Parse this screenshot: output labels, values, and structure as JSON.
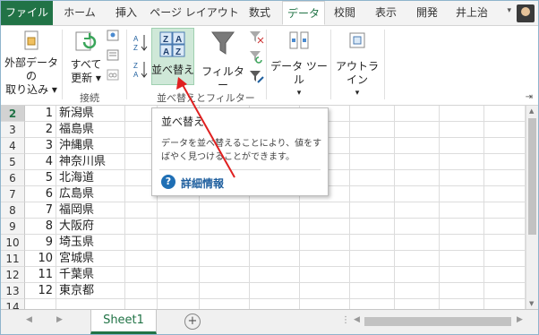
{
  "tabs": {
    "file": "ファイル",
    "home": "ホーム",
    "insert": "挿入",
    "page_layout": "ページ レイアウト",
    "formulas": "数式",
    "data": "データ",
    "review": "校閲",
    "view": "表示",
    "developer": "開発",
    "user": "井上治"
  },
  "ribbon": {
    "external_data": [
      "外部データの",
      "取り込み ▾"
    ],
    "refresh_all": [
      "すべて",
      "更新 ▾"
    ],
    "connections_group": "接続",
    "sort": "並べ替え",
    "filter": "フィルター",
    "sort_filter_group": "並べ替えとフィルター",
    "data_tools": "データ ツール",
    "outline": "アウトライン"
  },
  "tooltip": {
    "title": "並べ替え",
    "body_line1": "データを並べ替えることにより、値をす",
    "body_line2": "ばやく見つけることができます。",
    "more_info": "詳細情報"
  },
  "rows": [
    {
      "num": "2",
      "a": "1",
      "b": "新潟県"
    },
    {
      "num": "3",
      "a": "2",
      "b": "福島県"
    },
    {
      "num": "4",
      "a": "3",
      "b": "沖縄県"
    },
    {
      "num": "5",
      "a": "4",
      "b": "神奈川県"
    },
    {
      "num": "6",
      "a": "5",
      "b": "北海道"
    },
    {
      "num": "7",
      "a": "6",
      "b": "広島県"
    },
    {
      "num": "8",
      "a": "7",
      "b": "福岡県"
    },
    {
      "num": "9",
      "a": "8",
      "b": "大阪府"
    },
    {
      "num": "10",
      "a": "9",
      "b": "埼玉県"
    },
    {
      "num": "11",
      "a": "10",
      "b": "宮城県"
    },
    {
      "num": "12",
      "a": "11",
      "b": "千葉県"
    },
    {
      "num": "13",
      "a": "12",
      "b": "東京都"
    },
    {
      "num": "14",
      "a": "",
      "b": ""
    }
  ],
  "sheet_tab": "Sheet1",
  "add_sheet": "+",
  "colors": {
    "accent": "#217346",
    "arrow": "#e02020",
    "link": "#1f5f9e"
  }
}
